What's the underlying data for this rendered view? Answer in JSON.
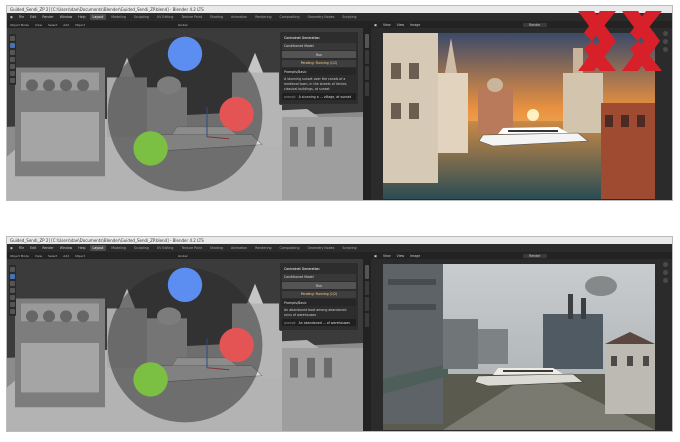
{
  "shots": [
    {
      "id": "top",
      "window_title": "Guided_Sendi_ZP 2] [C:\\Users\\dae\\Documents\\Blender\\Guided_Sendi_ZP.blend] - Blender 4.2 LTS",
      "menus": [
        "File",
        "Edit",
        "Render",
        "Window",
        "Help"
      ],
      "workspaces": [
        "Layout",
        "Modeling",
        "Sculpting",
        "UV Editing",
        "Texture Paint",
        "Shading",
        "Animation",
        "Rendering",
        "Compositing",
        "Geometry Nodes",
        "Scripting"
      ],
      "active_workspace": "Layout",
      "viewport_header": [
        "Object Mode",
        "View",
        "Select",
        "Add",
        "Object"
      ],
      "transform": "Global",
      "image_header": [
        "View",
        "View",
        "Image"
      ],
      "image_name": "Render",
      "panel": {
        "title": "Controlnet Generation",
        "model_label": "Conditioned Model",
        "run_label": "Run",
        "status": "Pending: Running (1/2)",
        "section": "Prompts/Basic",
        "prompt_text": "A stunning sunset over the canals of a medieval town, in the streets of Venice, classical buildings, at sunset",
        "prompt_label": "prompt",
        "prompt_value": "A stunning a ... village, at sunset"
      },
      "render_theme": "venice-sunset"
    },
    {
      "id": "bottom",
      "window_title": "Guided_Sendi_ZP 2] [C:\\Users\\dae\\Documents\\Blender\\Guided_Sendi_ZP.blend] - Blender 4.2 LTS",
      "menus": [
        "File",
        "Edit",
        "Render",
        "Window",
        "Help"
      ],
      "workspaces": [
        "Layout",
        "Modeling",
        "Sculpting",
        "UV Editing",
        "Texture Paint",
        "Shading",
        "Animation",
        "Rendering",
        "Compositing",
        "Geometry Nodes",
        "Scripting"
      ],
      "active_workspace": "Layout",
      "viewport_header": [
        "Object Mode",
        "View",
        "Select",
        "Add",
        "Object"
      ],
      "transform": "Global",
      "image_header": [
        "View",
        "View",
        "Image"
      ],
      "image_name": "Render",
      "panel": {
        "title": "Controlnet Generation",
        "model_label": "Conditioned Model",
        "run_label": "Run",
        "status": "Pending: Running (1/2)",
        "section": "Prompts/Basic",
        "prompt_text": "An abandoned boat among abandoned ruins of warehouses",
        "prompt_label": "prompt",
        "prompt_value": "An abandoned ... of warehouses"
      },
      "render_theme": "abandoned-industrial"
    }
  ],
  "colors": {
    "blender_bg": "#1d1d1d",
    "viewport": "#3d3d3d",
    "accent": "#4772b3",
    "logo_red": "#d8202a"
  },
  "icons": {
    "logo": "double-x-logo"
  }
}
